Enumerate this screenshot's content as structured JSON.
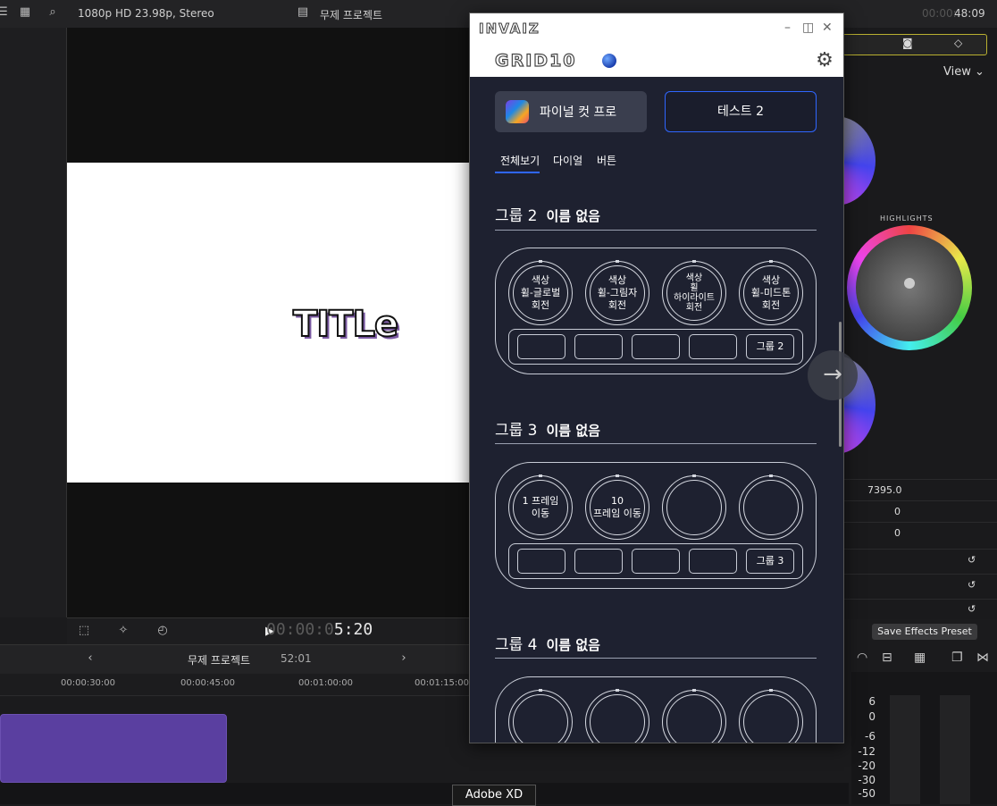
{
  "fcp": {
    "viewer_info": "1080p HD 23.98p, Stereo",
    "project_title": "무제 프로젝트",
    "timecode_dim": "00:00:0",
    "timecode_bright": "5:20",
    "top_right_time_dim": "00:00:",
    "top_right_time": "48:09",
    "title_text": "TITLe",
    "view_label": "View",
    "highlights_label": "HIGHLIGHTS",
    "values": [
      "7395.0",
      "0",
      "0"
    ],
    "save_preset": "Save Effects Preset",
    "timeline_project": "무제 프로젝트",
    "timeline_duration": "52:01",
    "ruler_ticks": [
      "00:00:30:00",
      "00:00:45:00",
      "00:01:00:00",
      "00:01:15:00"
    ],
    "meter_labels": [
      "6",
      "0",
      "-6",
      "-12",
      "-20",
      "-30",
      "-50"
    ],
    "dock_tooltip": "Adobe XD"
  },
  "plugin": {
    "brand": "INVAIZ",
    "product": "GRID10",
    "app_button": "파이널 컷 프로",
    "test_button": "테스트 2",
    "tabs": [
      "전체보기",
      "다이얼",
      "버튼"
    ],
    "groups": [
      {
        "label": "그룹 2",
        "name": "이름 없음",
        "knobs": [
          "색상\n휠-글로벌\n회전",
          "색상\n휠-그림자\n회전",
          "색상\n휠\n하이라이트\n회전",
          "색상\n휠-미드톤\n회전"
        ],
        "buttons": [
          "",
          "",
          "",
          "",
          "그룹 2"
        ]
      },
      {
        "label": "그룹 3",
        "name": "이름 없음",
        "knobs": [
          "1 프레임\n이동",
          "10\n프레임 이동",
          "",
          ""
        ],
        "buttons": [
          "",
          "",
          "",
          "",
          "그룹 3"
        ]
      },
      {
        "label": "그룹 4",
        "name": "이름 없음",
        "knobs": [
          "",
          "",
          "",
          ""
        ],
        "buttons": []
      }
    ]
  }
}
